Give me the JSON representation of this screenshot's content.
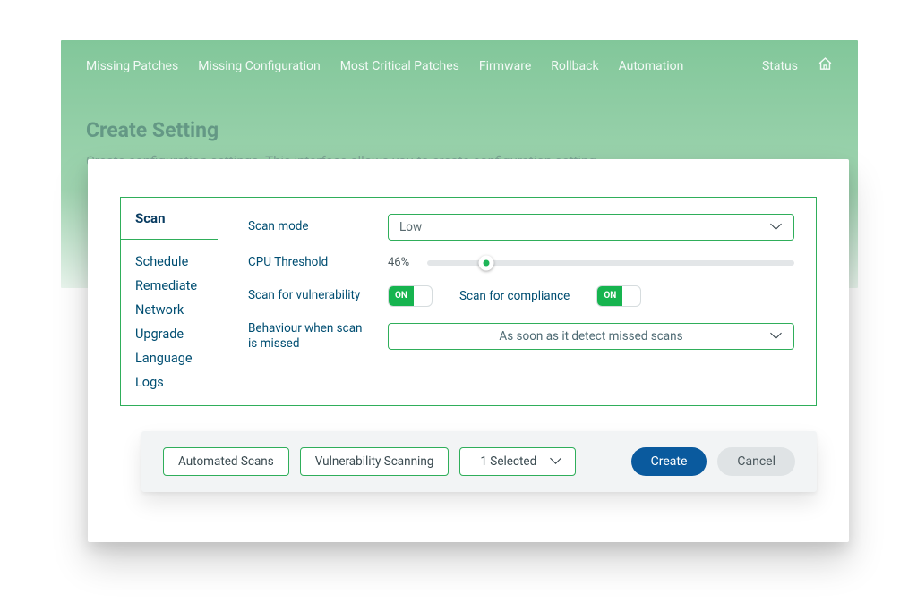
{
  "nav": {
    "items": [
      "Missing Patches",
      "Missing Configuration",
      "Most Critical Patches",
      "Firmware",
      "Rollback",
      "Automation"
    ],
    "status_label": "Status"
  },
  "hero": {
    "title": "Create Setting",
    "subtitle": "Create configuration settings. This interface allows you to create configuration setting"
  },
  "tabs": {
    "active": "Scan",
    "items": [
      "Schedule",
      "Remediate",
      "Network",
      "Upgrade",
      "Language",
      "Logs"
    ]
  },
  "panel": {
    "scan_mode_label": "Scan mode",
    "scan_mode_value": "Low",
    "cpu_threshold_label": "CPU Threshold",
    "cpu_threshold_value": "46%",
    "cpu_threshold_percent": 16,
    "scan_vuln_label": "Scan for vulnerability",
    "scan_vuln_toggle": "ON",
    "scan_comp_label": "Scan for compliance",
    "scan_comp_toggle": "ON",
    "behaviour_label": "Behaviour when scan is missed",
    "behaviour_value": "As soon as it detect missed scans"
  },
  "actions": {
    "chip1": "Automated Scans",
    "chip2": "Vulnerability Scanning",
    "select_label": "1 Selected",
    "create": "Create",
    "cancel": "Cancel"
  }
}
